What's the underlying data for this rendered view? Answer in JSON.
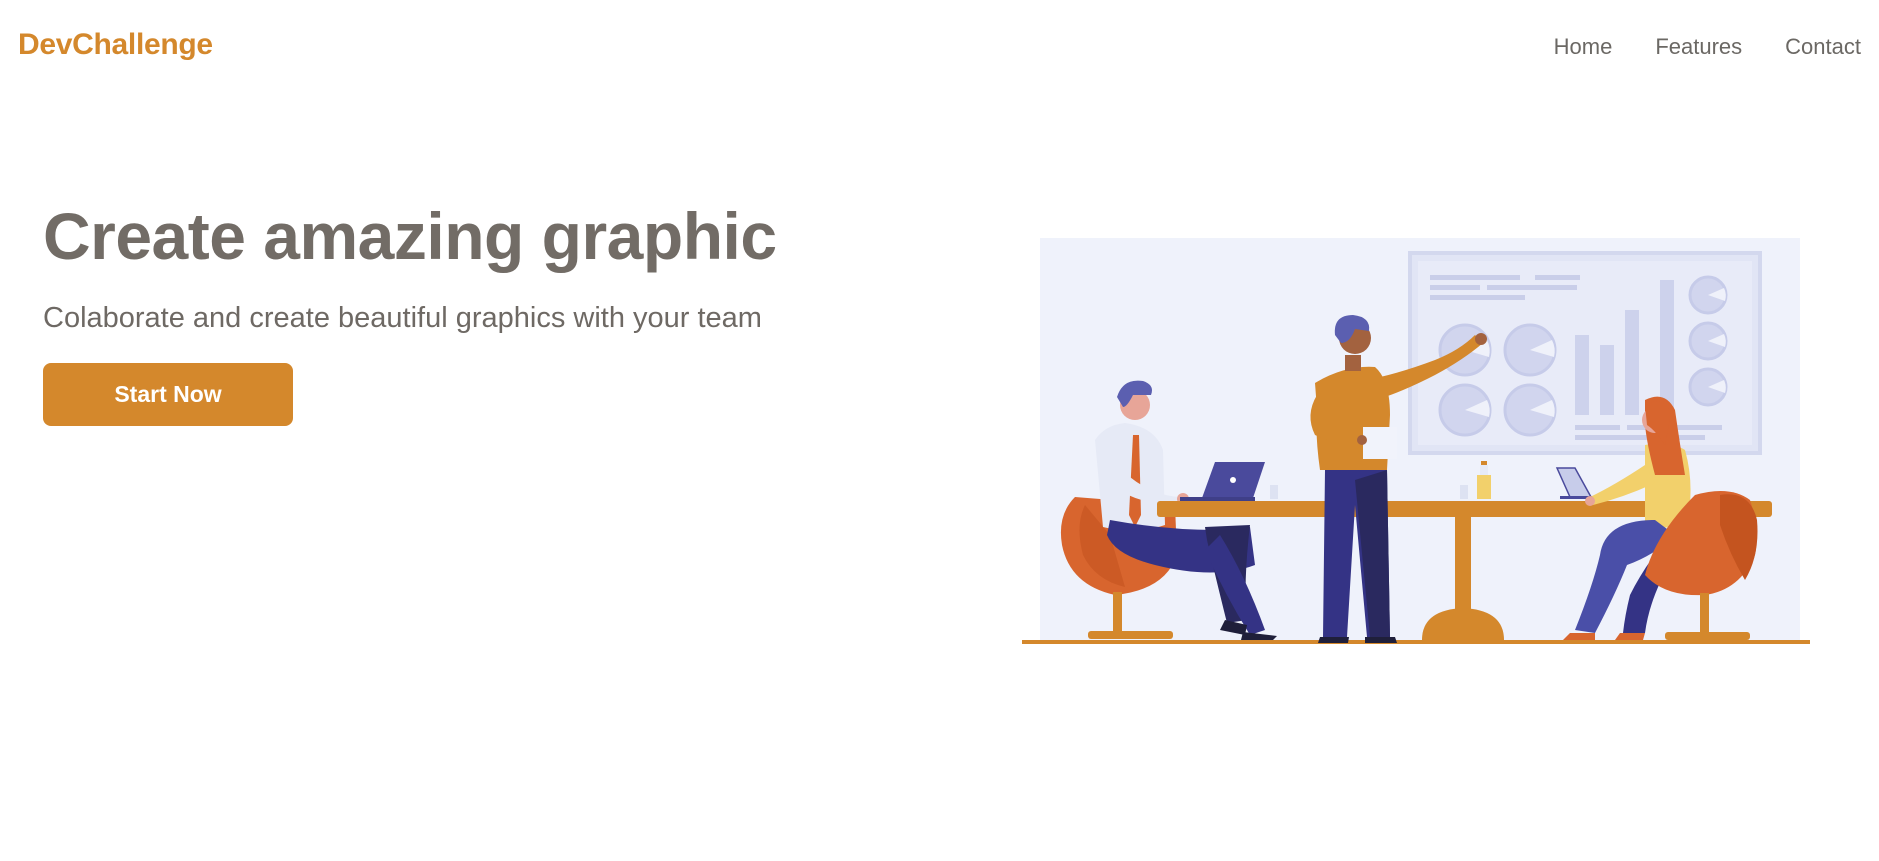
{
  "header": {
    "brand": "DevChallenge",
    "nav": [
      {
        "label": "Home"
      },
      {
        "label": "Features"
      },
      {
        "label": "Contact"
      }
    ]
  },
  "hero": {
    "title": "Create amazing graphic",
    "subtitle": "Colaborate and create beautiful graphics with your team",
    "cta_label": "Start Now"
  },
  "colors": {
    "accent": "#D4882C",
    "heading": "#726C66",
    "body_text": "#6E6964",
    "illustration_bg": "#EFF2FB",
    "navy": "#343385",
    "chair": "#D8652E"
  },
  "illustration": {
    "icon": "team-meeting-illustration"
  }
}
